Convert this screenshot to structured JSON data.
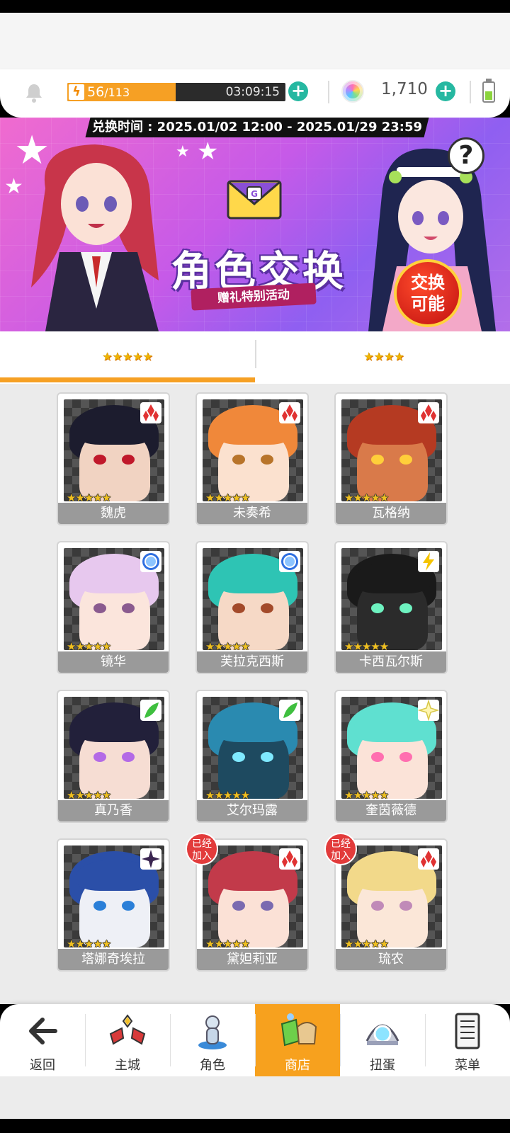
{
  "hud": {
    "stamina_current": "56",
    "stamina_max": "/113",
    "stamina_fraction": 0.4956,
    "timer": "03:09:15",
    "gems": "1,710"
  },
  "banner": {
    "period": "兑换时间 : 2025.01/02 12:00 - 2025.01/29 23:59",
    "title": "角色交换",
    "subtitle": "赠礼特别活动",
    "badge_line1": "交换",
    "badge_line2": "可能",
    "help": "?"
  },
  "tabs": [
    {
      "label": "★★★★★",
      "active": true
    },
    {
      "label": "★★★★",
      "active": false
    }
  ],
  "stars5": "★★★★★",
  "characters": [
    {
      "name": "魏虎",
      "attr": "red-diamond",
      "hair": "#1c1c2e",
      "skin": "#f1d3c2",
      "eye": "#c0182a",
      "joined": false
    },
    {
      "name": "未奏希",
      "attr": "red-diamond",
      "hair": "#f0883a",
      "skin": "#fbe1cf",
      "eye": "#b8742a",
      "joined": false
    },
    {
      "name": "瓦格纳",
      "attr": "red-diamond",
      "hair": "#b53a22",
      "skin": "#d97a4a",
      "eye": "#ffcf3a",
      "joined": false
    },
    {
      "name": "镜华",
      "attr": "blue-circle",
      "hair": "#e7c8ee",
      "skin": "#fbe5dc",
      "eye": "#8a5a8f",
      "joined": false
    },
    {
      "name": "芙拉克西斯",
      "attr": "blue-circle",
      "hair": "#2ec4b4",
      "skin": "#f6d9c6",
      "eye": "#a34a2a",
      "joined": false
    },
    {
      "name": "卡西瓦尔斯",
      "attr": "yellow-bolt",
      "hair": "#1a1a1a",
      "skin": "#2b2b2b",
      "eye": "#6ef2c0",
      "joined": false
    },
    {
      "name": "真乃香",
      "attr": "green-leaf",
      "hair": "#22203a",
      "skin": "#f6ddd3",
      "eye": "#b36ae6",
      "joined": false
    },
    {
      "name": "艾尔玛露",
      "attr": "green-leaf",
      "hair": "#2a8ab0",
      "skin": "#1e4a60",
      "eye": "#7fe9ff",
      "joined": false
    },
    {
      "name": "奎茵薇德",
      "attr": "light-star",
      "hair": "#5fe0d0",
      "skin": "#fbe3d8",
      "eye": "#ff6fb0",
      "joined": false
    },
    {
      "name": "塔娜奇埃拉",
      "attr": "dark-star",
      "hair": "#2b4fa8",
      "skin": "#eef0f6",
      "eye": "#2a7fd8",
      "joined": false
    },
    {
      "name": "黛妲莉亚",
      "attr": "red-diamond",
      "hair": "#c23a4a",
      "skin": "#fbe1d6",
      "eye": "#7a6ab0",
      "joined": true
    },
    {
      "name": "琉农",
      "attr": "red-diamond",
      "hair": "#f2d98a",
      "skin": "#fbe7d8",
      "eye": "#c08ab8",
      "joined": true
    }
  ],
  "joined_label_1": "已经",
  "joined_label_2": "加入",
  "nav": [
    {
      "label": "返回",
      "icon": "back-arrow-icon",
      "active": false
    },
    {
      "label": "主城",
      "icon": "town-icon",
      "active": false
    },
    {
      "label": "角色",
      "icon": "character-icon",
      "active": false
    },
    {
      "label": "商店",
      "icon": "shop-icon",
      "active": true
    },
    {
      "label": "扭蛋",
      "icon": "gacha-icon",
      "active": false
    },
    {
      "label": "菜单",
      "icon": "menu-list-icon",
      "active": false
    }
  ],
  "colors": {
    "accent": "#f6a024",
    "plus": "#26b8a1",
    "name_bar": "#9a9a9a",
    "joined_badge": "#e23b3b"
  }
}
